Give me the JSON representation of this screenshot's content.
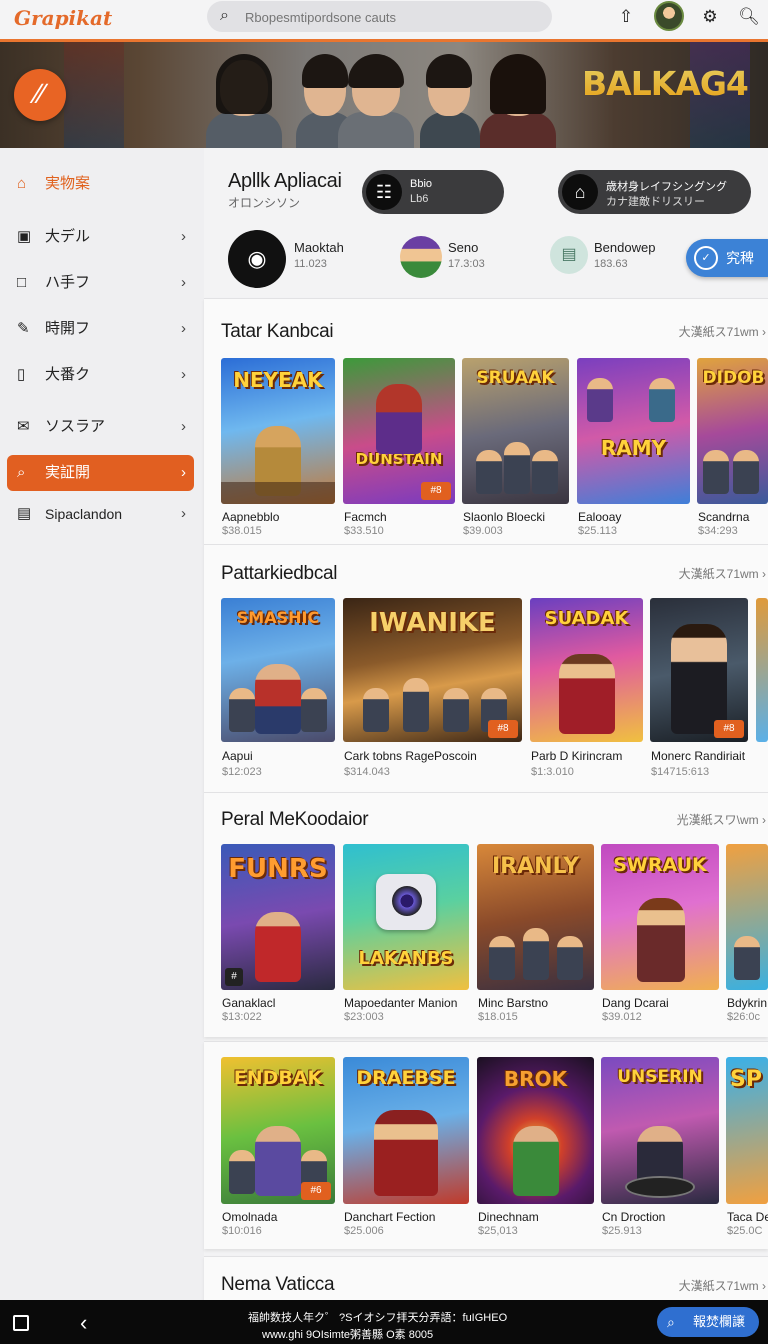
{
  "topbar": {
    "logo": "Grapikat",
    "search_placeholder": "Rbopesmtipordsone cauts",
    "icons": [
      "download-icon",
      "avatar",
      "gear-icon",
      "search-icon"
    ]
  },
  "hero": {
    "brand": "BALKAG4"
  },
  "sidebar": {
    "items": [
      {
        "label": "実物案",
        "icon": "home-icon"
      },
      {
        "label": "大デル",
        "icon": "game-icon"
      },
      {
        "label": "ハ手フ",
        "icon": "app-icon"
      },
      {
        "label": "時開フ",
        "icon": "pencil-icon"
      },
      {
        "label": "大番ク",
        "icon": "bookmark-icon"
      },
      {
        "label": "ソスラア",
        "icon": "mail-icon"
      },
      {
        "label": "実証開",
        "icon": "search-icon"
      },
      {
        "label": "Sipaclandon",
        "icon": "list-icon"
      }
    ]
  },
  "app": {
    "title": "Apllk Apliacai",
    "subtitle": "オロンシソン",
    "pill1": {
      "line1": "Bbio",
      "line2": "Lb6"
    },
    "pill2": {
      "line1": "歳材身レイフシングング",
      "line2": "カナ建敵ドリスリー"
    },
    "categories": [
      {
        "name": "Maoktah",
        "value": "11.023"
      },
      {
        "name": "Seno",
        "value": "17.3:03"
      },
      {
        "name": "Bendowep",
        "value": "183.63"
      }
    ],
    "pin_button": "究稗"
  },
  "sections": [
    {
      "title": "Tatar Kanbcai",
      "more": "大漢紙ス71wm",
      "items": [
        {
          "art": "NEYEAK",
          "name": "Aapnebblo",
          "price": "$38.015",
          "badge": ""
        },
        {
          "art": "DUNSTAIN",
          "name": "Facmch",
          "price": "$33.510",
          "badge": "#8"
        },
        {
          "art": "SRUAAK",
          "name": "Slaonlo Bloecki",
          "price": "$39.003",
          "badge": ""
        },
        {
          "art": "RAMY",
          "name": "Ealooay",
          "price": "$25.113",
          "badge": ""
        },
        {
          "art": "DIDOB",
          "name": "Scandrna",
          "price": "$34:293",
          "badge": ""
        }
      ]
    },
    {
      "title": "Pattarkiedbcal",
      "more": "大漢紙ス71wm",
      "items": [
        {
          "art": "SMASHIC",
          "name": "Aapui",
          "price": "$12:023",
          "badge": ""
        },
        {
          "art": "IWANIKE",
          "name": "Cark tobns RagePoscoin",
          "price": "$314.043",
          "badge": "#8"
        },
        {
          "art": "SUADAK",
          "name": "Parb D Kirincram",
          "price": "$1:3.010",
          "badge": ""
        },
        {
          "art": "",
          "name": "Monerc Randiriait",
          "price": "$14715:613",
          "badge": "#8"
        },
        {
          "art": "",
          "name": "",
          "price": "",
          "badge": ""
        }
      ]
    },
    {
      "title": "Peral MeKoodaior",
      "more": "光漢紙スワ\\wm",
      "items": [
        {
          "art": "FUNRS",
          "name": "Ganaklacl",
          "price": "$13:022",
          "badge": "#"
        },
        {
          "art": "LAKANBS",
          "name": "Mapoedanter Manion",
          "price": "$23:003",
          "badge": ""
        },
        {
          "art": "IRANLY",
          "name": "Minc Barstno",
          "price": "$18.015",
          "badge": ""
        },
        {
          "art": "SWRAUK",
          "name": "Dang Dcarai",
          "price": "$39.012",
          "badge": ""
        },
        {
          "art": "",
          "name": "Bdykrin",
          "price": "$26:0c",
          "badge": ""
        }
      ]
    },
    {
      "title": "",
      "more": "",
      "items": [
        {
          "art": "ENDBAK",
          "name": "Omolnada",
          "price": "$10:016",
          "badge": "#6"
        },
        {
          "art": "DRAEBSE",
          "name": "Danchart Fection",
          "price": "$25.006",
          "badge": ""
        },
        {
          "art": "BROK",
          "name": "Dinechnam",
          "price": "$25,013",
          "badge": ""
        },
        {
          "art": "UNSERIN",
          "name": "Cn Droction",
          "price": "$25.913",
          "badge": ""
        },
        {
          "art": "SP",
          "name": "Taca De",
          "price": "$25.0C",
          "badge": ""
        }
      ]
    },
    {
      "title": "Nema Vaticca",
      "more": "大漢紙ス71wm",
      "items": []
    }
  ],
  "bottombar": {
    "line1": "福帥数技人年ク゜ ?Sイオシフ拝天分弄語：fuIGHEO",
    "line2": "www.ghi 9OIsimte粥善縣 O素 8005",
    "button": "報焚欄譲"
  }
}
